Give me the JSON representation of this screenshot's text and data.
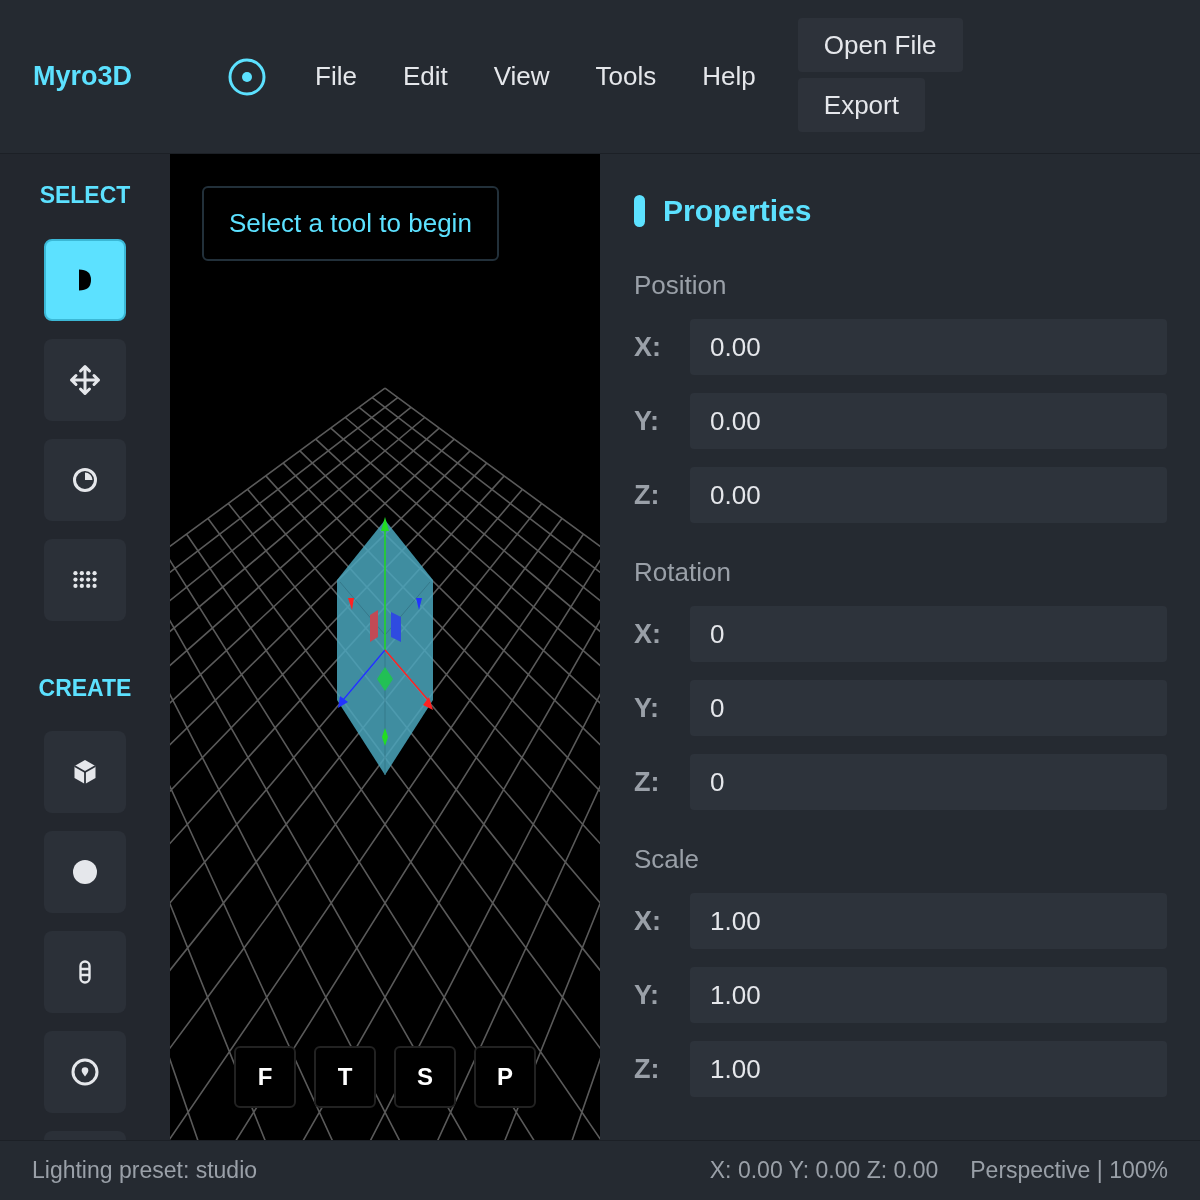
{
  "app": {
    "logo": "Myro3D"
  },
  "menu": [
    {
      "label": "File"
    },
    {
      "label": "Edit"
    },
    {
      "label": "View"
    },
    {
      "label": "Tools"
    },
    {
      "label": "Help"
    }
  ],
  "header_buttons": [
    {
      "label": "Open File"
    },
    {
      "label": "Export"
    }
  ],
  "sidebar": {
    "sections": [
      {
        "title": "SELECT",
        "tools": [
          {
            "selected": true
          },
          {
            "selected": false
          },
          {
            "selected": false
          },
          {
            "selected": false
          }
        ]
      },
      {
        "title": "CREATE",
        "tools": [
          {
            "selected": false
          },
          {
            "selected": false
          },
          {
            "selected": false
          },
          {
            "selected": false
          },
          {
            "selected": false
          }
        ]
      }
    ]
  },
  "viewport": {
    "hint": "Select a tool to begin",
    "view_buttons": [
      {
        "label": "F"
      },
      {
        "label": "T"
      },
      {
        "label": "S"
      },
      {
        "label": "P"
      }
    ]
  },
  "properties": {
    "title": "Properties",
    "groups": [
      {
        "title": "Position",
        "fields": [
          {
            "axis": "X:",
            "value": "0.00"
          },
          {
            "axis": "Y:",
            "value": "0.00"
          },
          {
            "axis": "Z:",
            "value": "0.00"
          }
        ]
      },
      {
        "title": "Rotation",
        "fields": [
          {
            "axis": "X:",
            "value": "0"
          },
          {
            "axis": "Y:",
            "value": "0"
          },
          {
            "axis": "Z:",
            "value": "0"
          }
        ]
      },
      {
        "title": "Scale",
        "fields": [
          {
            "axis": "X:",
            "value": "1.00"
          },
          {
            "axis": "Y:",
            "value": "1.00"
          },
          {
            "axis": "Z:",
            "value": "1.00"
          }
        ]
      }
    ]
  },
  "status_bar": {
    "left": "Lighting preset: studio",
    "coordinates": "X: 0.00 Y: 0.00 Z: 0.00",
    "view_mode": "Perspective | 100%"
  }
}
